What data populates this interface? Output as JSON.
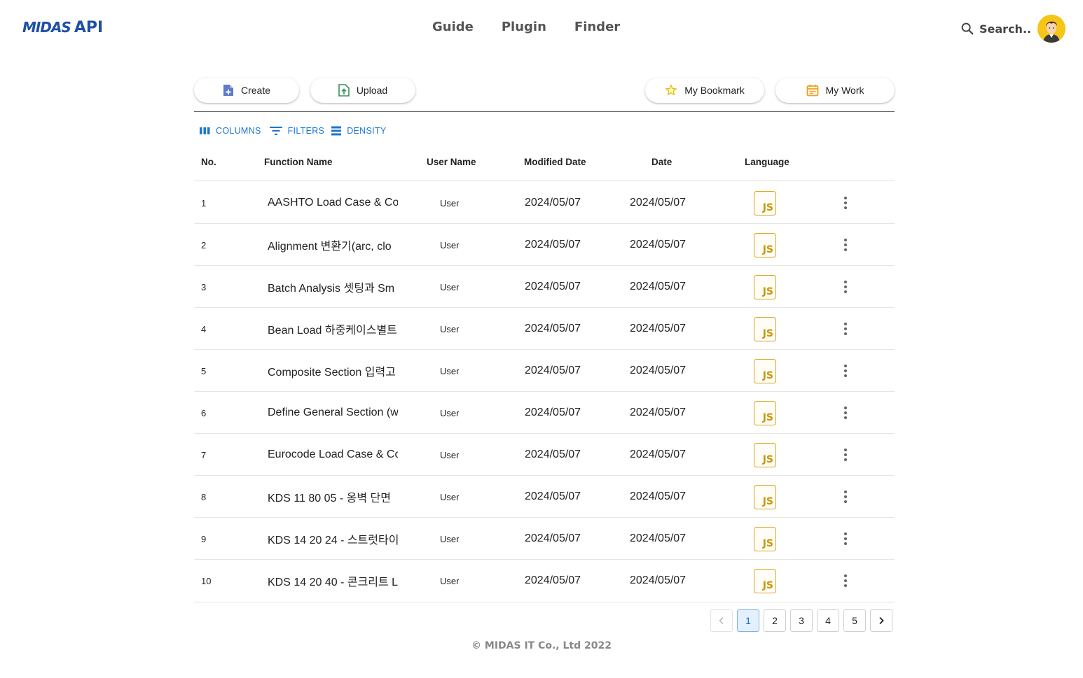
{
  "header": {
    "logo_brand": "MIDAS",
    "logo_product": "API",
    "nav": [
      {
        "label": "Guide"
      },
      {
        "label": "Plugin"
      },
      {
        "label": "Finder"
      }
    ],
    "search_label": "Search.."
  },
  "toolbar": {
    "create_label": "Create",
    "upload_label": "Upload",
    "bookmark_label": "My Bookmark",
    "mywork_label": "My Work"
  },
  "grid_tools": {
    "columns_label": "COLUMNS",
    "filters_label": "FILTERS",
    "density_label": "DENSITY"
  },
  "table": {
    "headers": {
      "no": "No.",
      "function_name": "Function Name",
      "user_name": "User Name",
      "modified_date": "Modified Date",
      "date": "Date",
      "language": "Language"
    },
    "rows": [
      {
        "no": "1",
        "function_name": "AASHTO Load Case & Cor",
        "user": "User",
        "modified": "2024/05/07",
        "date": "2024/05/07",
        "language": "JS"
      },
      {
        "no": "2",
        "function_name": "Alignment 변환기(arc, clo",
        "user": "User",
        "modified": "2024/05/07",
        "date": "2024/05/07",
        "language": "JS"
      },
      {
        "no": "3",
        "function_name": "Batch Analysis 셋팅과 Sm",
        "user": "User",
        "modified": "2024/05/07",
        "date": "2024/05/07",
        "language": "JS"
      },
      {
        "no": "4",
        "function_name": "Bean Load 하중케이스별트",
        "user": "User",
        "modified": "2024/05/07",
        "date": "2024/05/07",
        "language": "JS"
      },
      {
        "no": "5",
        "function_name": "Composite Section 입력고",
        "user": "User",
        "modified": "2024/05/07",
        "date": "2024/05/07",
        "language": "JS"
      },
      {
        "no": "6",
        "function_name": "Define General Section (w",
        "user": "User",
        "modified": "2024/05/07",
        "date": "2024/05/07",
        "language": "JS"
      },
      {
        "no": "7",
        "function_name": "Eurocode Load Case & Co",
        "user": "User",
        "modified": "2024/05/07",
        "date": "2024/05/07",
        "language": "JS"
      },
      {
        "no": "8",
        "function_name": "KDS 11 80 05 - 옹벽 단면",
        "user": "User",
        "modified": "2024/05/07",
        "date": "2024/05/07",
        "language": "JS"
      },
      {
        "no": "9",
        "function_name": "KDS 14 20 24 - 스트럿타이",
        "user": "User",
        "modified": "2024/05/07",
        "date": "2024/05/07",
        "language": "JS"
      },
      {
        "no": "10",
        "function_name": "KDS 14 20 40 - 콘크리트 L",
        "user": "User",
        "modified": "2024/05/07",
        "date": "2024/05/07",
        "language": "JS"
      }
    ]
  },
  "pagination": {
    "pages": [
      "1",
      "2",
      "3",
      "4",
      "5"
    ],
    "current": "1"
  },
  "footer": {
    "copyright": "© MIDAS IT Co., Ltd 2022"
  },
  "colors": {
    "brand": "#1f4fa8",
    "accent": "#1976d2",
    "js_badge": "#c9960c",
    "avatar_bg": "#f5c518"
  }
}
